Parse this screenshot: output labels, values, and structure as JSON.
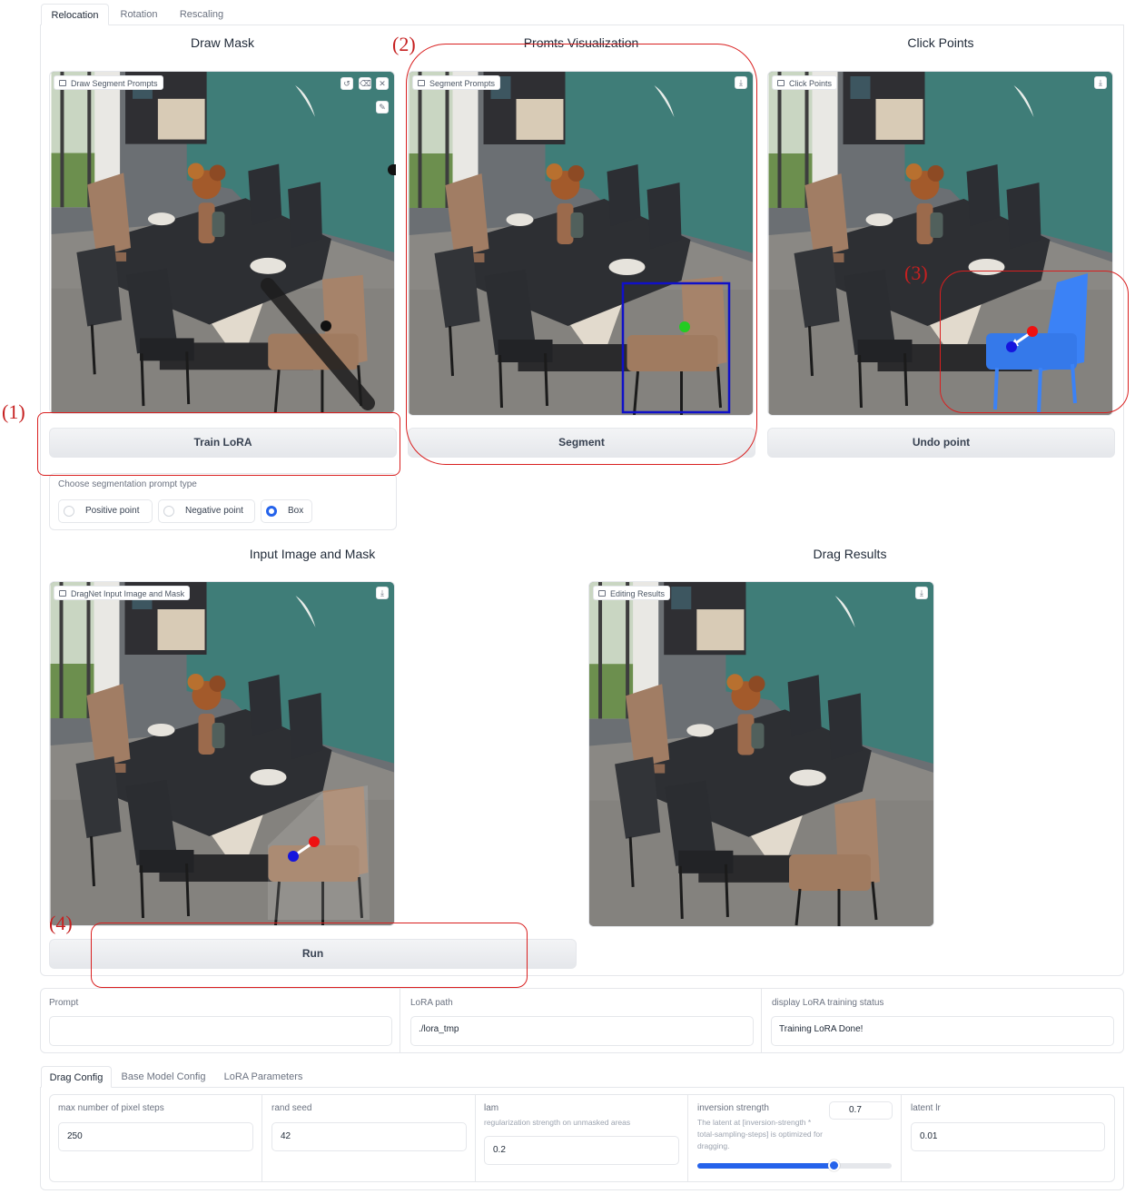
{
  "top_tabs": [
    "Relocation",
    "Rotation",
    "Rescaling"
  ],
  "sections": {
    "draw_mask": {
      "title": "Draw Mask",
      "image_label": "Draw Segment Prompts",
      "button": "Train LoRA"
    },
    "prompts_vis": {
      "title": "Promts Visualization",
      "image_label": "Segment Prompts",
      "button": "Segment"
    },
    "click_points": {
      "title": "Click Points",
      "image_label": "Click Points",
      "button": "Undo point"
    },
    "input_image": {
      "title": "Input Image and Mask",
      "image_label": "DragNet Input Image and Mask",
      "button": "Run"
    },
    "drag_results": {
      "title": "Drag Results",
      "image_label": "Editing Results"
    }
  },
  "segmentation": {
    "title": "Choose segmentation prompt type",
    "options": [
      "Positive point",
      "Negative point",
      "Box"
    ],
    "selected": "Box"
  },
  "fields": {
    "prompt": {
      "label": "Prompt",
      "value": ""
    },
    "lora_path": {
      "label": "LoRA path",
      "value": "./lora_tmp"
    },
    "lora_status": {
      "label": "display LoRA training status",
      "value": "Training LoRA Done!"
    }
  },
  "config_tabs": [
    "Drag Config",
    "Base Model Config",
    "LoRA Parameters"
  ],
  "drag_config": {
    "pixel_steps": {
      "label": "max number of pixel steps",
      "value": "250"
    },
    "rand_seed": {
      "label": "rand seed",
      "value": "42"
    },
    "lam": {
      "label": "lam",
      "hint": "regularization strength on unmasked areas",
      "value": "0.2"
    },
    "inversion": {
      "label": "inversion strength",
      "hint": "The latent at [inversion-strength * total-sampling-steps] is optimized for dragging.",
      "value": "0.7",
      "slider_fraction": 0.7
    },
    "latent_lr": {
      "label": "latent lr",
      "value": "0.01"
    }
  },
  "annotations": [
    "(1)",
    "(2)",
    "(3)",
    "(4)"
  ],
  "colors": {
    "annotation_red": "#d91f1f",
    "accent_blue": "#2563eb",
    "box_blue": "#1010c8",
    "point_green": "#22cc22",
    "handle_red": "#ee1111",
    "target_blue": "#1515dd",
    "mask_chair_blue": "#3b82f6",
    "wall_teal": "#3f7d78"
  },
  "icons": {
    "image_label": "image-icon",
    "undo": "undo-icon",
    "erase": "eraser-icon",
    "close": "close-icon",
    "brush": "brush-icon",
    "download": "download-icon"
  }
}
